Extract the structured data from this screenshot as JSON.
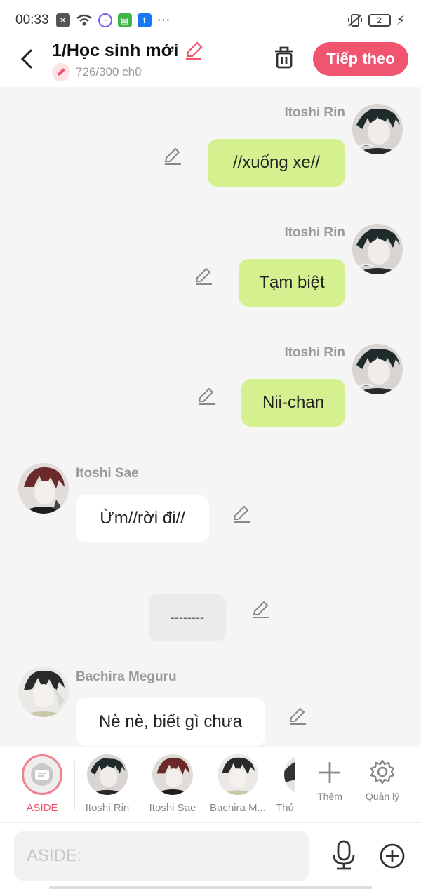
{
  "status": {
    "time": "00:33",
    "more": "···",
    "battery": "2"
  },
  "header": {
    "title": "1/Học sinh mới",
    "subtitle": "726/300 chữ",
    "next_label": "Tiếp theo"
  },
  "messages": [
    {
      "name": "Itoshi Rin",
      "text": "//xuống xe//"
    },
    {
      "name": "Itoshi Rin",
      "text": "Tạm biệt"
    },
    {
      "name": "Itoshi Rin",
      "text": "Nii-chan"
    },
    {
      "name": "Itoshi Sae",
      "text": "Ừm//rời đi//"
    },
    {
      "text": "--------"
    },
    {
      "name": "Bachira Meguru",
      "text": "Nè nè, biết gì chưa"
    }
  ],
  "tabs": [
    {
      "label": "ASIDE"
    },
    {
      "label": "Itoshi Rin"
    },
    {
      "label": "Itoshi Sae"
    },
    {
      "label": "Bachira M..."
    },
    {
      "label": "Thủ"
    }
  ],
  "tools": {
    "add_label": "Thêm",
    "manage_label": "Quản lý"
  },
  "input": {
    "placeholder": "ASIDE:"
  },
  "colors": {
    "accent": "#f0546e",
    "bubble_green": "#d5f18f"
  }
}
